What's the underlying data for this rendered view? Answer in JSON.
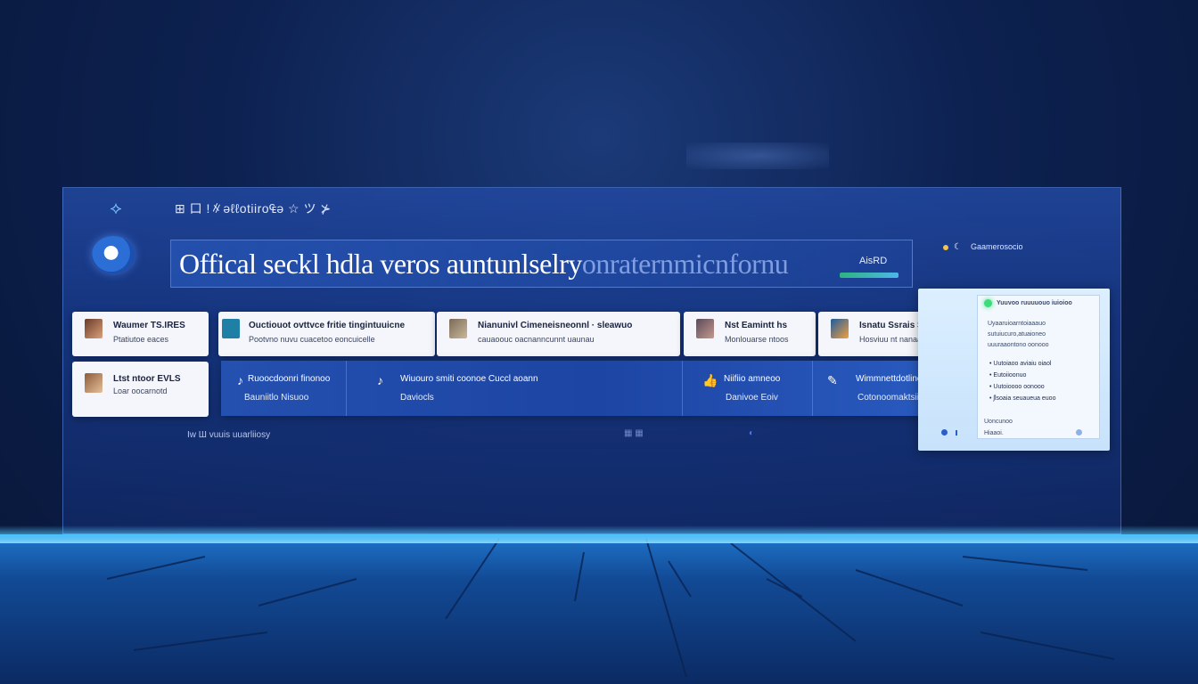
{
  "topbar": {
    "text": "⊞ 口 !∦ǝℓℓotiiro₠ǝ ☆ ツ ⊁"
  },
  "banner": {
    "title_main": "Offical seckl hdla veros auntunlselry",
    "title_faded": "onraternmicnfornu",
    "tag": "AisRD"
  },
  "status": {
    "label": "Gaamerosocio"
  },
  "cards_row1": [
    {
      "title": "Waumer TS.IRES",
      "sub": "Ptatiutoe eaces"
    },
    {
      "title": "Ouctiouot ovttvce fritie tingintuuicne",
      "sub": "Pootvno nuvu cuacetoo eoncuicelle"
    },
    {
      "title": "Nianunivl Cimeneisneonnl · sleawuo",
      "sub": "cauaoouc oacnanncunnt uaunau"
    },
    {
      "title": "Nst Eamintt hs",
      "sub": "Monlouarse ntoos"
    },
    {
      "title": "Isnatu Ssrais Sttine",
      "sub": "Hosviuu nt nanaarr"
    }
  ],
  "card_left2": {
    "title": "Ltst ntoor EVLS",
    "sub": "Loar oocarnotd"
  },
  "blue_cells": [
    {
      "icon": "♪",
      "l1": "Ruoocdoonri finonoo",
      "l2": "Bauniitlo  Nisuoo"
    },
    {
      "icon": "♪",
      "l1": "Wiuouro smiti coonoe Cuccl aoann",
      "l2": "Daviocls"
    },
    {
      "icon": "👍",
      "l1": "Niifiio amneoo",
      "l2": "Danivoe Eoiv"
    },
    {
      "icon": "✎",
      "l1": "Wimmnettdotlinocoon",
      "l2": "Cotonoomaktsiiho"
    }
  ],
  "footer": {
    "text": "Iw  Ш vuuis uuarliiosy"
  },
  "side_panel": {
    "heading": "Yuuvoo ruuuuouo iuioioo",
    "lines": [
      "Uyaaruioarntoiaaauo",
      "sutuiucuro,atuaioneo",
      "uuuraaontono oonooo"
    ],
    "bullets": [
      "Uutoiaoo aviaiu oiaol",
      "Eutoiioonuo",
      "Uutoioooo oonooo",
      "ʃlsoaia seuaueua euoo"
    ],
    "footer_lines": [
      "Uoncunoo",
      "Hiaaoi."
    ]
  }
}
